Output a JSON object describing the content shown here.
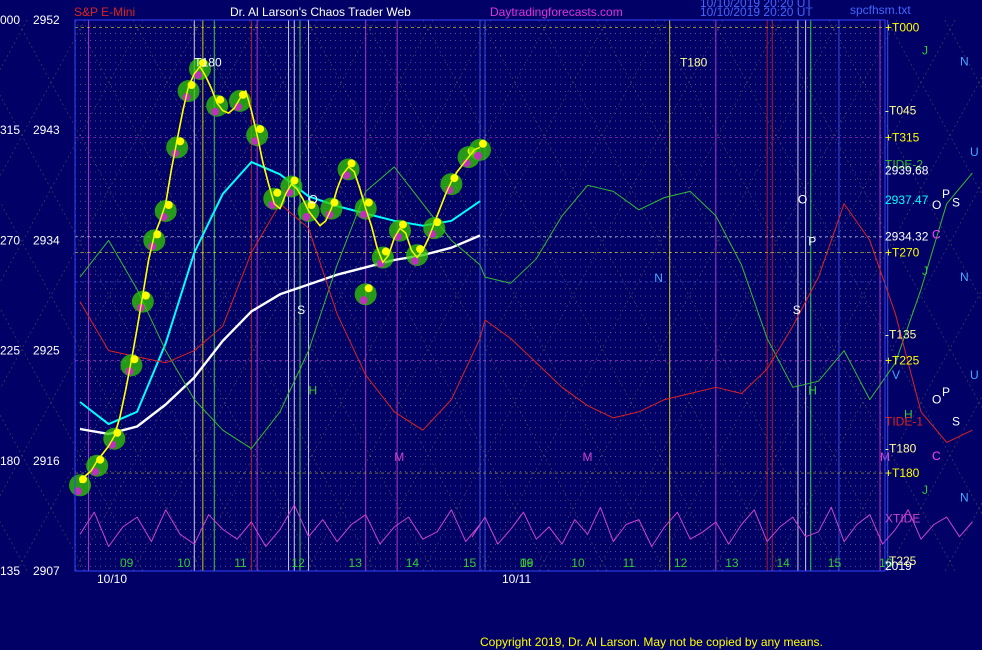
{
  "header": {
    "instrument": "S&P E-Mini",
    "title": "Dr. Al Larson's Chaos Trader Web",
    "site": "Daytradingforecasts.com",
    "stamp_line1": "10/10/2019 20:20 UT",
    "stamp_line2": "10/10/2019 20:20 UT",
    "file": "spcfhsm.txt"
  },
  "footer": {
    "copyright": "Copyright 2019, Dr. Al Larson. May not be copied by any means."
  },
  "colors": {
    "background": "#000066",
    "grid": "#4444ff",
    "price": "#ffff00",
    "glow": "#33cc00",
    "fast_ma": "#00ffff",
    "slow_ma": "#ffffff",
    "tide": "#33bb33",
    "xtide": "#cc44cc",
    "red_tide": "#dd2222"
  },
  "chart_data": {
    "type": "line",
    "y_axis": {
      "price_ticks": [
        2952,
        2943,
        2934,
        2925,
        2916,
        2907
      ],
      "angle_ticks": [
        "000",
        "315",
        "270",
        "225",
        "180",
        "135"
      ],
      "ylim": [
        2907,
        2952
      ]
    },
    "x_axis": {
      "hour_labels_day1": [
        "09",
        "10",
        "11",
        "12",
        "13",
        "14",
        "15",
        "16"
      ],
      "hour_labels_day2": [
        "09",
        "10",
        "11",
        "12",
        "13",
        "14",
        "15",
        "16"
      ],
      "date_labels": [
        "10/10",
        "10/11"
      ]
    },
    "right_labels": [
      {
        "text": "+T000",
        "price": 2951.4,
        "color": "#ffff00"
      },
      {
        "text": "J",
        "price": 2949.5,
        "color": "#33cc33"
      },
      {
        "text": "N",
        "price": 2948.6,
        "color": "#44aaff"
      },
      {
        "text": "-T045",
        "price": 2944.6,
        "color": "#ffff99"
      },
      {
        "text": "+T315",
        "price": 2942.4,
        "color": "#ffff00"
      },
      {
        "text": "U",
        "price": 2941.2,
        "color": "#44aaff"
      },
      {
        "text": "TIDE-2",
        "price": 2940.2,
        "color": "#33bb33"
      },
      {
        "text": "2939.68",
        "price": 2939.7,
        "color": "#ffffff"
      },
      {
        "text": "P",
        "price": 2937.8,
        "color": "#ffffff"
      },
      {
        "text": "2937.47",
        "price": 2937.3,
        "color": "#00ffff"
      },
      {
        "text": "O",
        "price": 2936.9,
        "color": "#ffffff"
      },
      {
        "text": "S",
        "price": 2937.1,
        "color": "#ffffff"
      },
      {
        "text": "2934.32",
        "price": 2934.3,
        "color": "#ffffff"
      },
      {
        "text": "C",
        "price": 2934.5,
        "color": "#ff44ff"
      },
      {
        "text": "+T270",
        "price": 2933.0,
        "color": "#ffff00"
      },
      {
        "text": "J",
        "price": 2931.5,
        "color": "#33cc33"
      },
      {
        "text": "N",
        "price": 2931.0,
        "color": "#44aaff"
      },
      {
        "text": "-T135",
        "price": 2926.3,
        "color": "#ffff99"
      },
      {
        "text": "+T225",
        "price": 2924.2,
        "color": "#ffff00"
      },
      {
        "text": "V",
        "price": 2923.0,
        "color": "#44aaff"
      },
      {
        "text": "U",
        "price": 2923.0,
        "color": "#44aaff"
      },
      {
        "text": "P",
        "price": 2921.6,
        "color": "#ffffff"
      },
      {
        "text": "O",
        "price": 2921.0,
        "color": "#ffffff"
      },
      {
        "text": "H",
        "price": 2919.8,
        "color": "#33cc33"
      },
      {
        "text": "TIDE-1",
        "price": 2919.2,
        "color": "#dd2222"
      },
      {
        "text": "S",
        "price": 2919.2,
        "color": "#ffffff"
      },
      {
        "text": "-T180",
        "price": 2917.0,
        "color": "#ffff99"
      },
      {
        "text": "C",
        "price": 2916.4,
        "color": "#ff44ff"
      },
      {
        "text": "+T180",
        "price": 2915.0,
        "color": "#ffff00"
      },
      {
        "text": "J",
        "price": 2913.6,
        "color": "#33cc33"
      },
      {
        "text": "N",
        "price": 2913.0,
        "color": "#44aaff"
      },
      {
        "text": "XTIDE",
        "price": 2911.3,
        "color": "#cc44cc"
      },
      {
        "text": "-T225",
        "price": 2907.8,
        "color": "#ffff99"
      },
      {
        "text": "2019",
        "price": 2907.4,
        "color": "#ffffff"
      }
    ],
    "chart_letters": [
      {
        "text": "T180",
        "hour": 11.0,
        "price": 2948.2,
        "color": "#ffffff"
      },
      {
        "text": "T180",
        "hour": 20.3,
        "price": 2948.2,
        "color": "#ffff99"
      },
      {
        "text": "O",
        "hour": 13.0,
        "price": 2937.0,
        "color": "#ffffff"
      },
      {
        "text": "O",
        "hour": 22.6,
        "price": 2937.0,
        "color": "#ffffff"
      },
      {
        "text": "P",
        "hour": 22.8,
        "price": 2933.6,
        "color": "#ffffff"
      },
      {
        "text": "N",
        "hour": 19.8,
        "price": 2930.6,
        "color": "#44aaff"
      },
      {
        "text": "S",
        "hour": 12.8,
        "price": 2928.0,
        "color": "#ffffff"
      },
      {
        "text": "S",
        "hour": 22.5,
        "price": 2928.0,
        "color": "#ffffff"
      },
      {
        "text": "H",
        "hour": 13.0,
        "price": 2921.4,
        "color": "#33cc33"
      },
      {
        "text": "H",
        "hour": 22.8,
        "price": 2921.4,
        "color": "#33cc33"
      },
      {
        "text": "M",
        "hour": 14.5,
        "price": 2916.0,
        "color": "#cc44cc"
      },
      {
        "text": "M",
        "hour": 18.4,
        "price": 2916.0,
        "color": "#cc44cc"
      },
      {
        "text": "M",
        "hour": 24.2,
        "price": 2916.0,
        "color": "#cc44cc"
      }
    ],
    "series": [
      {
        "name": "S&P E-Mini",
        "x": [
          9.0,
          9.1,
          9.2,
          9.3,
          9.4,
          9.5,
          9.6,
          9.7,
          9.8,
          9.9,
          10.0,
          10.1,
          10.2,
          10.3,
          10.4,
          10.5,
          10.6,
          10.7,
          10.8,
          10.9,
          11.0,
          11.1,
          11.2,
          11.3,
          11.4,
          11.5,
          11.6,
          11.7,
          11.8,
          11.9,
          12.0,
          12.1,
          12.2,
          12.3,
          12.4,
          12.5,
          12.6,
          12.7,
          12.8,
          12.9,
          13.0,
          13.1,
          13.2,
          13.3,
          13.4,
          13.5,
          13.6,
          13.7,
          13.8,
          13.9,
          14.0,
          14.1,
          14.2,
          14.3,
          14.4,
          14.5,
          14.6,
          14.7,
          14.8,
          14.9,
          15.0,
          15.1,
          15.2,
          15.3,
          15.4,
          15.5,
          15.6,
          15.7,
          15.8,
          15.9,
          16.0
        ],
        "values": [
          2914.2,
          2914.8,
          2915.2,
          2916.0,
          2916.6,
          2917.2,
          2918.0,
          2919.6,
          2921.8,
          2924.2,
          2926.8,
          2929.6,
          2932.4,
          2934.4,
          2935.6,
          2937.0,
          2939.8,
          2942.2,
          2944.6,
          2946.6,
          2947.6,
          2948.2,
          2947.4,
          2946.4,
          2945.2,
          2944.6,
          2944.4,
          2944.8,
          2945.6,
          2946.2,
          2944.6,
          2942.6,
          2940.4,
          2938.6,
          2937.0,
          2936.6,
          2937.8,
          2938.6,
          2938.2,
          2937.4,
          2936.4,
          2935.8,
          2935.2,
          2935.6,
          2936.6,
          2938.2,
          2939.4,
          2940.0,
          2939.6,
          2938.2,
          2936.6,
          2935.2,
          2933.4,
          2932.2,
          2932.8,
          2934.2,
          2935.0,
          2934.6,
          2933.2,
          2932.6,
          2933.2,
          2934.2,
          2935.4,
          2936.6,
          2937.8,
          2938.8,
          2939.6,
          2940.2,
          2940.8,
          2941.4,
          2941.6
        ],
        "color": "#ffff00"
      },
      {
        "name": "fast MA",
        "x": [
          9.0,
          9.5,
          10.0,
          10.5,
          11.0,
          11.5,
          12.0,
          12.5,
          13.0,
          13.5,
          14.0,
          14.5,
          15.0,
          15.5,
          16.0
        ],
        "values": [
          2920.8,
          2919.0,
          2920.0,
          2925.6,
          2933.0,
          2937.8,
          2940.4,
          2939.4,
          2937.6,
          2936.8,
          2936.2,
          2935.6,
          2935.2,
          2935.6,
          2937.2
        ],
        "color": "#00ffff"
      },
      {
        "name": "slow MA",
        "x": [
          9.0,
          9.5,
          10.0,
          10.5,
          11.0,
          11.5,
          12.0,
          12.5,
          13.0,
          13.5,
          14.0,
          14.5,
          15.0,
          15.5,
          16.0
        ],
        "values": [
          2918.6,
          2918.2,
          2918.8,
          2920.6,
          2922.8,
          2925.8,
          2928.2,
          2929.6,
          2930.4,
          2931.2,
          2931.8,
          2932.4,
          2932.8,
          2933.4,
          2934.4
        ],
        "color": "#ffffff"
      },
      {
        "name": "TIDE-2",
        "x": [
          9.0,
          9.5,
          10.0,
          10.5,
          11.0,
          11.5,
          12.0,
          12.5,
          13.0,
          13.5,
          14.0,
          14.5,
          15.0,
          15.5,
          16.0,
          16.5,
          17.0,
          17.5,
          18.0,
          18.5,
          19.0,
          19.5,
          20.0,
          20.5,
          21.0,
          21.5,
          22.0,
          22.5,
          23.0,
          23.5,
          24.0,
          24.5,
          25.0,
          25.5,
          26.0
        ],
        "values": [
          2931.0,
          2934.0,
          2930.0,
          2925.0,
          2921.0,
          2918.5,
          2917.0,
          2920.0,
          2925.0,
          2932.0,
          2938.0,
          2940.0,
          2937.0,
          2934.0,
          2932.0,
          2931.0,
          2930.5,
          2932.5,
          2936.0,
          2938.5,
          2938.0,
          2936.5,
          2937.5,
          2938.0,
          2936.0,
          2932.0,
          2926.0,
          2922.0,
          2922.5,
          2925.0,
          2921.0,
          2924.0,
          2930.0,
          2937.0,
          2939.5
        ],
        "color": "#33bb33"
      },
      {
        "name": "TIDE-1",
        "x": [
          9.0,
          9.5,
          10.0,
          10.5,
          11.0,
          11.5,
          12.0,
          12.5,
          13.0,
          13.5,
          14.0,
          14.5,
          15.0,
          15.5,
          16.0,
          16.5,
          17.0,
          17.5,
          18.0,
          18.5,
          19.0,
          19.5,
          20.0,
          20.5,
          21.0,
          21.5,
          22.0,
          22.5,
          23.0,
          23.5,
          24.0,
          24.5,
          25.0,
          25.5,
          26.0
        ],
        "values": [
          2929.0,
          2925.0,
          2924.5,
          2924.0,
          2925.0,
          2927.0,
          2933.0,
          2937.0,
          2935.0,
          2928.0,
          2923.0,
          2920.0,
          2918.5,
          2921.0,
          2926.0,
          2927.5,
          2926.0,
          2924.0,
          2922.0,
          2920.5,
          2919.5,
          2920.0,
          2921.0,
          2921.5,
          2922.0,
          2921.5,
          2923.5,
          2927.0,
          2931.0,
          2937.0,
          2934.0,
          2928.0,
          2920.0,
          2917.5,
          2918.5
        ],
        "color": "#dd2222"
      },
      {
        "name": "XTIDE",
        "x": [
          9.0,
          9.25,
          9.5,
          9.75,
          10.0,
          10.25,
          10.5,
          10.75,
          11.0,
          11.25,
          11.5,
          11.75,
          12.0,
          12.25,
          12.5,
          12.75,
          13.0,
          13.25,
          13.5,
          13.75,
          14.0,
          14.25,
          14.5,
          14.75,
          15.0,
          15.25,
          15.5,
          15.75,
          16.0,
          16.25,
          16.5,
          16.75,
          17.0,
          17.25,
          17.5,
          17.75,
          18.0,
          18.25,
          18.5,
          18.75,
          19.0,
          19.25,
          19.5,
          19.75,
          20.0,
          20.25,
          20.5,
          20.75,
          21.0,
          21.25,
          21.5,
          21.75,
          22.0,
          22.25,
          22.5,
          22.75,
          23.0,
          23.25,
          23.5,
          23.75,
          24.0,
          24.25,
          24.5,
          24.75,
          25.0,
          25.25,
          25.5,
          25.75,
          26.0
        ],
        "values": [
          2910.0,
          2911.8,
          2909.0,
          2910.6,
          2911.4,
          2909.4,
          2912.0,
          2910.0,
          2909.2,
          2911.6,
          2910.4,
          2909.6,
          2911.0,
          2909.0,
          2910.4,
          2912.4,
          2909.8,
          2911.2,
          2909.4,
          2910.8,
          2911.6,
          2909.2,
          2910.6,
          2911.4,
          2909.6,
          2910.2,
          2912.0,
          2909.4,
          2910.8,
          2909.8,
          2911.4,
          2909.2,
          2910.4,
          2911.8,
          2909.6,
          2910.6,
          2909.2,
          2911.2,
          2910.0,
          2912.2,
          2909.4,
          2910.8,
          2911.2,
          2909.0,
          2910.6,
          2911.8,
          2909.6,
          2910.2,
          2911.0,
          2909.2,
          2910.8,
          2912.0,
          2909.4,
          2910.6,
          2911.4,
          2909.8,
          2910.2,
          2912.2,
          2909.4,
          2910.8,
          2911.6,
          2909.2,
          2910.4,
          2912.0,
          2909.6,
          2910.8,
          2911.4,
          2909.8,
          2911.0
        ],
        "color": "#cc44cc"
      }
    ],
    "glow_points": [
      {
        "hour": 9.0,
        "price": 2914.0
      },
      {
        "hour": 9.3,
        "price": 2915.6
      },
      {
        "hour": 9.6,
        "price": 2917.8
      },
      {
        "hour": 9.9,
        "price": 2923.8
      },
      {
        "hour": 10.1,
        "price": 2929.0
      },
      {
        "hour": 10.3,
        "price": 2934.0
      },
      {
        "hour": 10.5,
        "price": 2936.4
      },
      {
        "hour": 10.7,
        "price": 2941.6
      },
      {
        "hour": 10.9,
        "price": 2946.2
      },
      {
        "hour": 11.1,
        "price": 2948.0
      },
      {
        "hour": 11.4,
        "price": 2945.0
      },
      {
        "hour": 11.8,
        "price": 2945.4
      },
      {
        "hour": 12.1,
        "price": 2942.6
      },
      {
        "hour": 12.4,
        "price": 2937.4
      },
      {
        "hour": 12.7,
        "price": 2938.4
      },
      {
        "hour": 13.0,
        "price": 2936.4
      },
      {
        "hour": 13.4,
        "price": 2936.6
      },
      {
        "hour": 13.7,
        "price": 2939.8
      },
      {
        "hour": 14.0,
        "price": 2936.6
      },
      {
        "hour": 14.0,
        "price": 2929.6
      },
      {
        "hour": 14.3,
        "price": 2932.6
      },
      {
        "hour": 14.6,
        "price": 2934.8
      },
      {
        "hour": 14.9,
        "price": 2932.8
      },
      {
        "hour": 15.2,
        "price": 2935.0
      },
      {
        "hour": 15.5,
        "price": 2938.6
      },
      {
        "hour": 15.8,
        "price": 2940.8
      },
      {
        "hour": 16.0,
        "price": 2941.4
      }
    ]
  }
}
